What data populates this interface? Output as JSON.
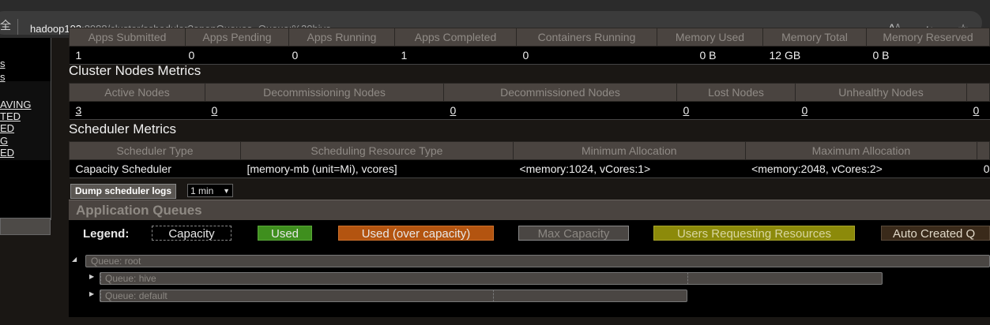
{
  "browser": {
    "security_glyph": "全",
    "url_host": "hadoop103",
    "url_rest": ":8088/cluster/scheduler?openQueues=Queue:%20hive",
    "icons": [
      "read-aloud-icon",
      "translate-icon",
      "favorite-star-icon"
    ]
  },
  "leftnav": {
    "items": [
      "s",
      "s",
      "AVING",
      "TED",
      "ED",
      "G",
      "ED"
    ]
  },
  "apps_metrics": {
    "headers": [
      "Apps Submitted",
      "Apps Pending",
      "Apps Running",
      "Apps Completed",
      "Containers Running",
      "Memory Used",
      "Memory Total",
      "Memory Reserved"
    ],
    "values": [
      "1",
      "0",
      "0",
      "1",
      "0",
      "0 B",
      "12 GB",
      "0 B"
    ]
  },
  "cluster_nodes": {
    "title": "Cluster Nodes Metrics",
    "headers": [
      "Active Nodes",
      "Decommissioning Nodes",
      "Decommissioned Nodes",
      "Lost Nodes",
      "Unhealthy Nodes",
      ""
    ],
    "values": [
      "3",
      "0",
      "0",
      "0",
      "0",
      "0"
    ]
  },
  "scheduler": {
    "title": "Scheduler Metrics",
    "headers": [
      "Scheduler Type",
      "Scheduling Resource Type",
      "Minimum Allocation",
      "Maximum Allocation"
    ],
    "values": [
      "Capacity Scheduler",
      "[memory-mb (unit=Mi), vcores]",
      "<memory:1024, vCores:1>",
      "<memory:2048, vCores:2>",
      "0"
    ]
  },
  "dump": {
    "button_label": "Dump scheduler logs",
    "select_value": "1 min"
  },
  "app_queues": {
    "title": "Application Queues",
    "legend_label": "Legend:",
    "legend": [
      "Capacity",
      "Used",
      "Used (over capacity)",
      "Max Capacity",
      "Users Requesting Resources",
      "Auto Created Q"
    ],
    "queues": [
      {
        "label": "Queue: root"
      },
      {
        "label": "Queue: hive"
      },
      {
        "label": "Queue: default"
      }
    ]
  },
  "colors": {
    "used": "#3f8f1e",
    "over_capacity": "#b35410",
    "users_requesting": "#8c8a0a",
    "accent_underline": "#f06a00"
  }
}
